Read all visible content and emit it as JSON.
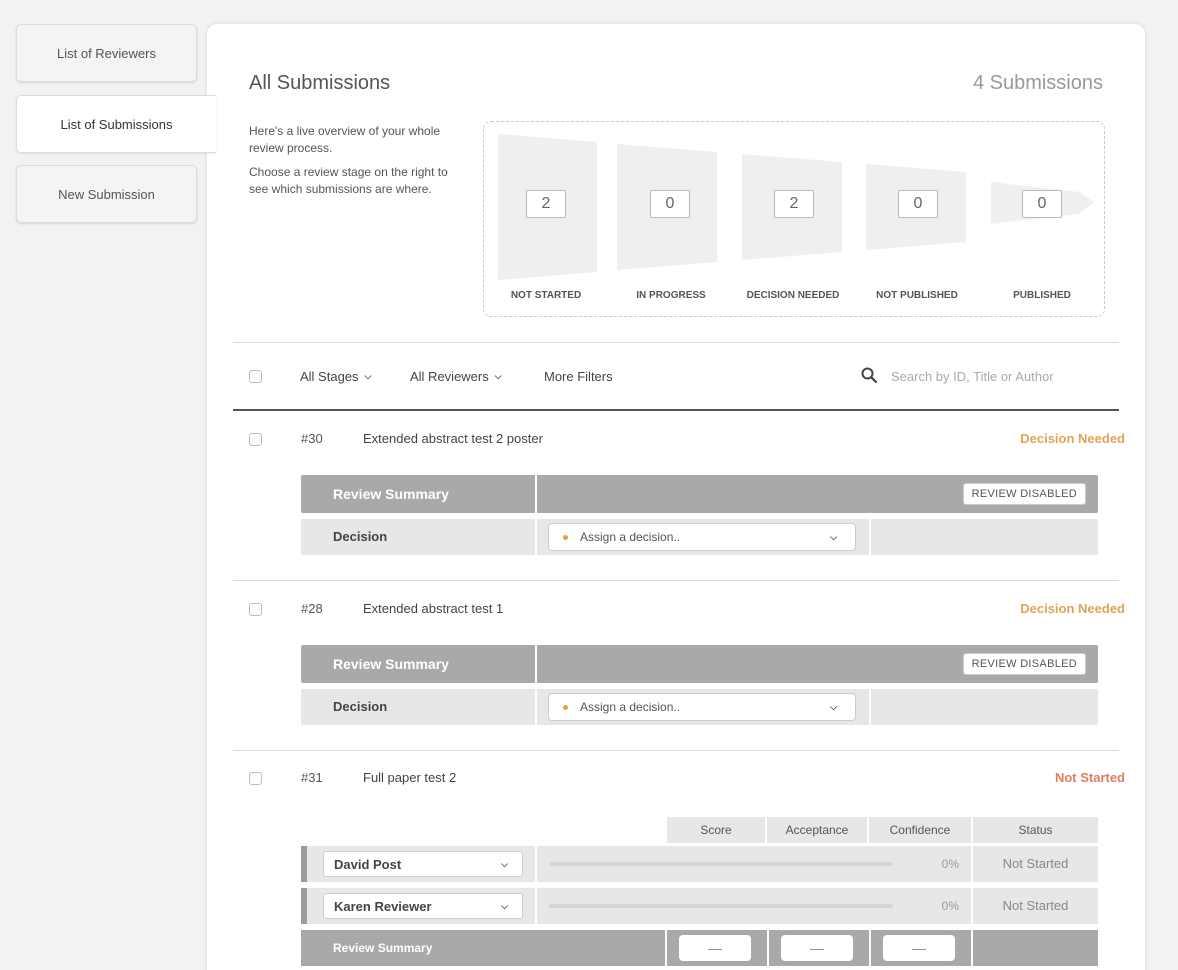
{
  "sidebar": {
    "items": [
      {
        "label": "List of Reviewers"
      },
      {
        "label": "List of Submissions"
      },
      {
        "label": "New Submission"
      }
    ]
  },
  "header": {
    "title": "All Submissions",
    "count": "4 Submissions"
  },
  "intro": {
    "line1": "Here's a live overview of your whole review process.",
    "line2": "Choose a review stage on the right to see which submissions are where."
  },
  "funnel": {
    "stages": [
      {
        "label": "NOT STARTED",
        "count": "2"
      },
      {
        "label": "IN PROGRESS",
        "count": "0"
      },
      {
        "label": "DECISION NEEDED",
        "count": "2"
      },
      {
        "label": "NOT PUBLISHED",
        "count": "0"
      },
      {
        "label": "PUBLISHED",
        "count": "0"
      }
    ]
  },
  "filters": {
    "stages": "All Stages",
    "reviewers": "All Reviewers",
    "more": "More Filters",
    "search_placeholder": "Search by ID, Title or Author"
  },
  "colors": {
    "decision_needed": "#e0a458",
    "not_started": "#e27d60",
    "decision_dot": "#e5a23c"
  },
  "submissions": [
    {
      "id": "#30",
      "title": "Extended abstract test 2 poster",
      "status": "Decision Needed",
      "summary_label": "Review Summary",
      "review_button": "REVIEW DISABLED",
      "decision_label": "Decision",
      "decision_placeholder": "Assign a decision.."
    },
    {
      "id": "#28",
      "title": "Extended abstract test 1",
      "status": "Decision Needed",
      "summary_label": "Review Summary",
      "review_button": "REVIEW DISABLED",
      "decision_label": "Decision",
      "decision_placeholder": "Assign a decision.."
    },
    {
      "id": "#31",
      "title": "Full paper test 2",
      "status": "Not Started",
      "columns": [
        "Score",
        "Acceptance",
        "Confidence",
        "Status"
      ],
      "reviewers": [
        {
          "name": "David Post",
          "progress": "0%",
          "progress_fraction": 0,
          "status": "Not Started"
        },
        {
          "name": "Karen Reviewer",
          "progress": "0%",
          "progress_fraction": 0,
          "status": "Not Started"
        }
      ],
      "summary_label": "Review Summary",
      "summary_values": [
        "—",
        "—",
        "—"
      ]
    }
  ]
}
